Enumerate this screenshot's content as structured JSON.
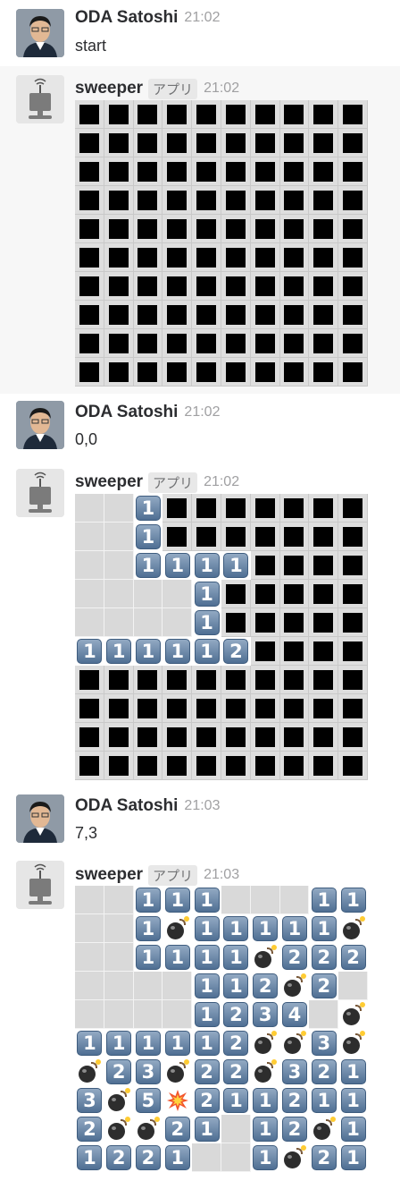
{
  "messages": [
    {
      "user": "ODA Satoshi",
      "time": "21:02",
      "text": "start",
      "avatar": "person-avatar"
    },
    {
      "user": "sweeper",
      "badge": "アプリ",
      "time": "21:02",
      "avatar": "robot-avatar",
      "board": [
        "##########",
        "##########",
        "##########",
        "##########",
        "##########",
        "##########",
        "##########",
        "##########",
        "##########",
        "##########"
      ]
    },
    {
      "user": "ODA Satoshi",
      "time": "21:02",
      "text": "0,0",
      "avatar": "person-avatar"
    },
    {
      "user": "sweeper",
      "badge": "アプリ",
      "time": "21:02",
      "avatar": "robot-avatar",
      "board": [
        "..1#######",
        "..1#######",
        "..1111####",
        "....1#####",
        "....1#####",
        "111112####",
        "##########",
        "##########",
        "##########",
        "##########"
      ]
    },
    {
      "user": "ODA Satoshi",
      "time": "21:03",
      "text": "7,3",
      "avatar": "person-avatar"
    },
    {
      "user": "sweeper",
      "badge": "アプリ",
      "time": "21:03",
      "avatar": "robot-avatar",
      "board": [
        "..111...11",
        "..1*11111*",
        "..1111*222",
        "....112*2.",
        "....1234.*",
        "111112**3*",
        "*23*22*321",
        "3*5X211211",
        "2**21.12*1",
        "1221..1*21"
      ]
    }
  ]
}
